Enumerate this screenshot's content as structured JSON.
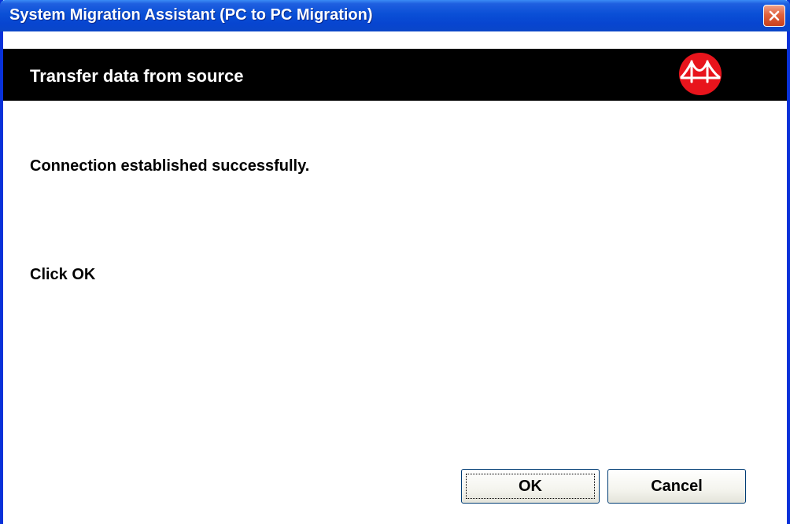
{
  "window": {
    "title": "System Migration Assistant (PC to PC Migration)"
  },
  "header": {
    "title": "Transfer data from source",
    "logo_icon": "bridge-logo-icon"
  },
  "content": {
    "status_message": "Connection established successfully.",
    "instruction": "Click OK"
  },
  "buttons": {
    "ok_label": "OK",
    "cancel_label": "Cancel"
  },
  "colors": {
    "titlebar": "#0a4fd6",
    "header_band": "#000000",
    "logo": "#e8141c",
    "close_button": "#e0623c"
  }
}
